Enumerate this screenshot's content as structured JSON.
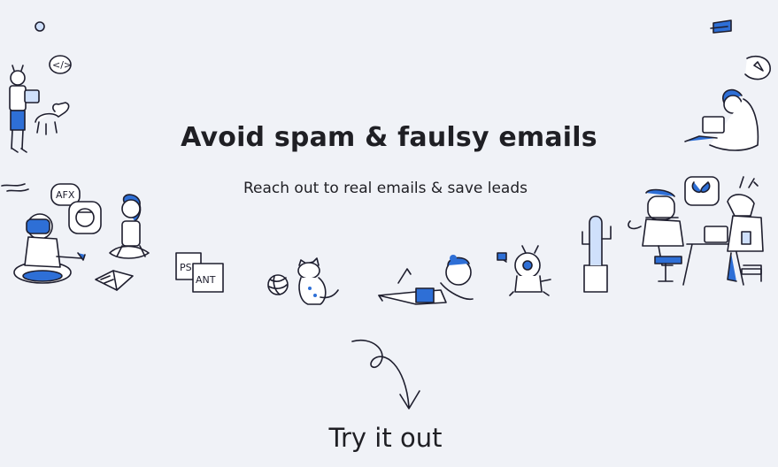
{
  "hero": {
    "title": "Avoid spam & faulsy emails",
    "subtitle": "Reach out to real emails & save leads",
    "cta_label": "Try it out"
  },
  "illustrations": {
    "box_left_label": "PS",
    "box_right_label": "ANT",
    "bubble_label": "AFX",
    "code_bubble_label": "</>"
  },
  "colors": {
    "background": "#f0f2f7",
    "accent": "#2e6fd6",
    "ink": "#1e1e2e"
  }
}
